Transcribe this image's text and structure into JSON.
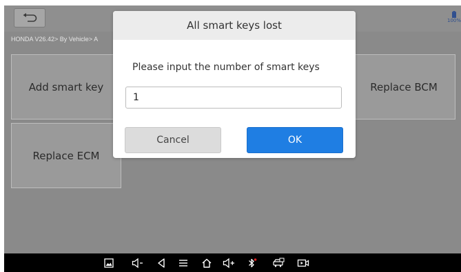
{
  "header": {
    "breadcrumb": "HONDA V26.42> By Vehicle> A",
    "battery_label": "100%"
  },
  "tiles": {
    "add_smart_key": "Add smart key",
    "replace_bcm": "Replace BCM",
    "replace_ecm": "Replace ECM"
  },
  "dialog": {
    "title": "All smart keys lost",
    "prompt": "Please input the number of smart keys",
    "input_value": "1",
    "cancel_label": "Cancel",
    "ok_label": "OK"
  },
  "navbar": {
    "icons": [
      "screenshot-icon",
      "volume-down-icon",
      "back-icon",
      "menu-icon",
      "home-icon",
      "volume-up-icon",
      "bluetooth-icon",
      "vci-icon",
      "screen-record-icon"
    ]
  },
  "colors": {
    "ok_button": "#1f7ee3",
    "overlay": "#8a8a8a",
    "bluetooth_dot": "#e02020"
  }
}
